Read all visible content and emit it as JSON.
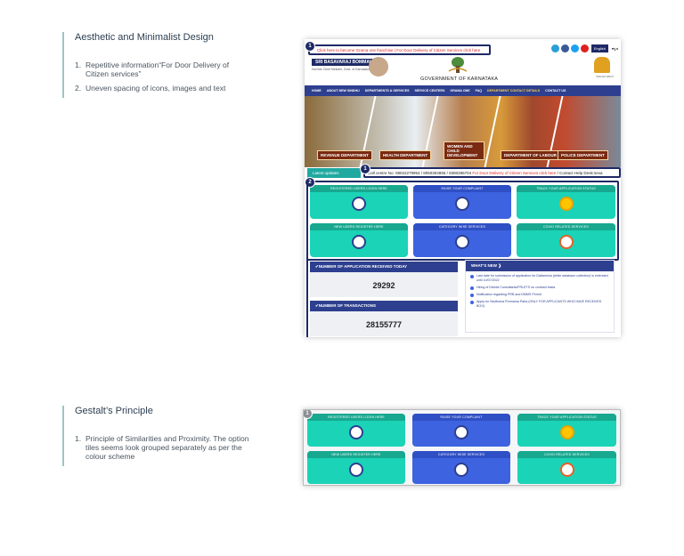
{
  "section1": {
    "title": "Aesthetic and Minimalist Design",
    "points": [
      {
        "num": "1.",
        "text": "Repetitive information“For Door Delivery of Citizen services”"
      },
      {
        "num": "2.",
        "text": "Uneven spacing of icons, images and text"
      }
    ]
  },
  "section2": {
    "title": "Gestalt’s Principle",
    "points": [
      {
        "num": "1.",
        "text": "Principle of Similarities and Proximity. The option tiles seems look grouped separately as per the colour scheme"
      }
    ]
  },
  "screenshot": {
    "badge1": "1",
    "badge2": "2",
    "marquee": "Click here to become Grama one franchise | For Door Delivery of Citizen Services click here",
    "portal_name": "SRI BASAVARAJ BOMMAI",
    "portal_sub": "Hon'ble Chief Minister, Govt. of Karnataka",
    "gov_title": "GOVERNMENT OF KARNATAKA",
    "lang_en": "English",
    "lang_kn": "ಕನ್ನಡ",
    "ka_text": "ಕರ್ನಾಟಕ ಸರ್ಕಾರ",
    "nav": [
      "HOME",
      "ABOUT NEW SINDHU",
      "DEPARTMENTS & SERVICES",
      "SERVICE CENTERS",
      "GRAMA ONE",
      "FAQ",
      "DEPARTMENT CONTACT DETAILS",
      "CONTACT US"
    ],
    "banner_labels": [
      "REVENUE DEPARTMENT",
      "HEALTH DEPARTMENT",
      "WOMEN AND CHILD DEVELOPMENT",
      "DEPARTMENT OF LABOUR",
      "POLICE DEPARTMENT"
    ],
    "latest_tab": "Latest updates",
    "callbar_text": "Call centre No: 08022279954 / 8050304855 / 9380286704",
    "callbar_red": "For Door Delivery of Citizen Services click here",
    "callbar_tail": "/ Contact Help Desk:seva",
    "tiles": [
      {
        "label": "REGISTERED USERS LOGIN HERE",
        "color": "teal",
        "icon": "fingerprint-icon"
      },
      {
        "label": "RAISE YOUR COMPLAINT",
        "color": "blue",
        "icon": "complaint-icon"
      },
      {
        "label": "TRACK YOUR APPLICATION STATUS",
        "color": "teal",
        "icon": "search-icon"
      },
      {
        "label": "NEW USERS REGISTER HERE",
        "color": "teal",
        "icon": "form-icon"
      },
      {
        "label": "CATEGORY WISE SERVICES",
        "color": "blue",
        "icon": "group-icon"
      },
      {
        "label": "COVID RELATED SERVICES",
        "color": "teal",
        "icon": "virus-icon"
      }
    ],
    "stat1_head": "✔NUMBER OF APPLICATION RECEIVED TODAY",
    "stat1_value": "29292",
    "stat2_head": "✔NUMBER OF TRANSACTIONS",
    "stat2_value": "28155777",
    "news_head": "WHAT'S NEW ❱",
    "news": [
      "Last date for submission of application for Dattamsha (white database collection) is extended until 10/07/2022",
      "Hiring of District Consultants/FRLETS on contract basis",
      "Notification regarding PRB and DMMS Permit",
      "Apply for Sindhutva Premama Patra (ONLY FOR APPLICANTS WHO HAVE RECEIVED BOO)"
    ]
  },
  "screenshot2": {
    "badge": "1"
  },
  "colors": {
    "teal": "#1bd3b6",
    "blue": "#3d63e0",
    "navy": "#1e2a66",
    "nav": "#2d3f8e"
  }
}
